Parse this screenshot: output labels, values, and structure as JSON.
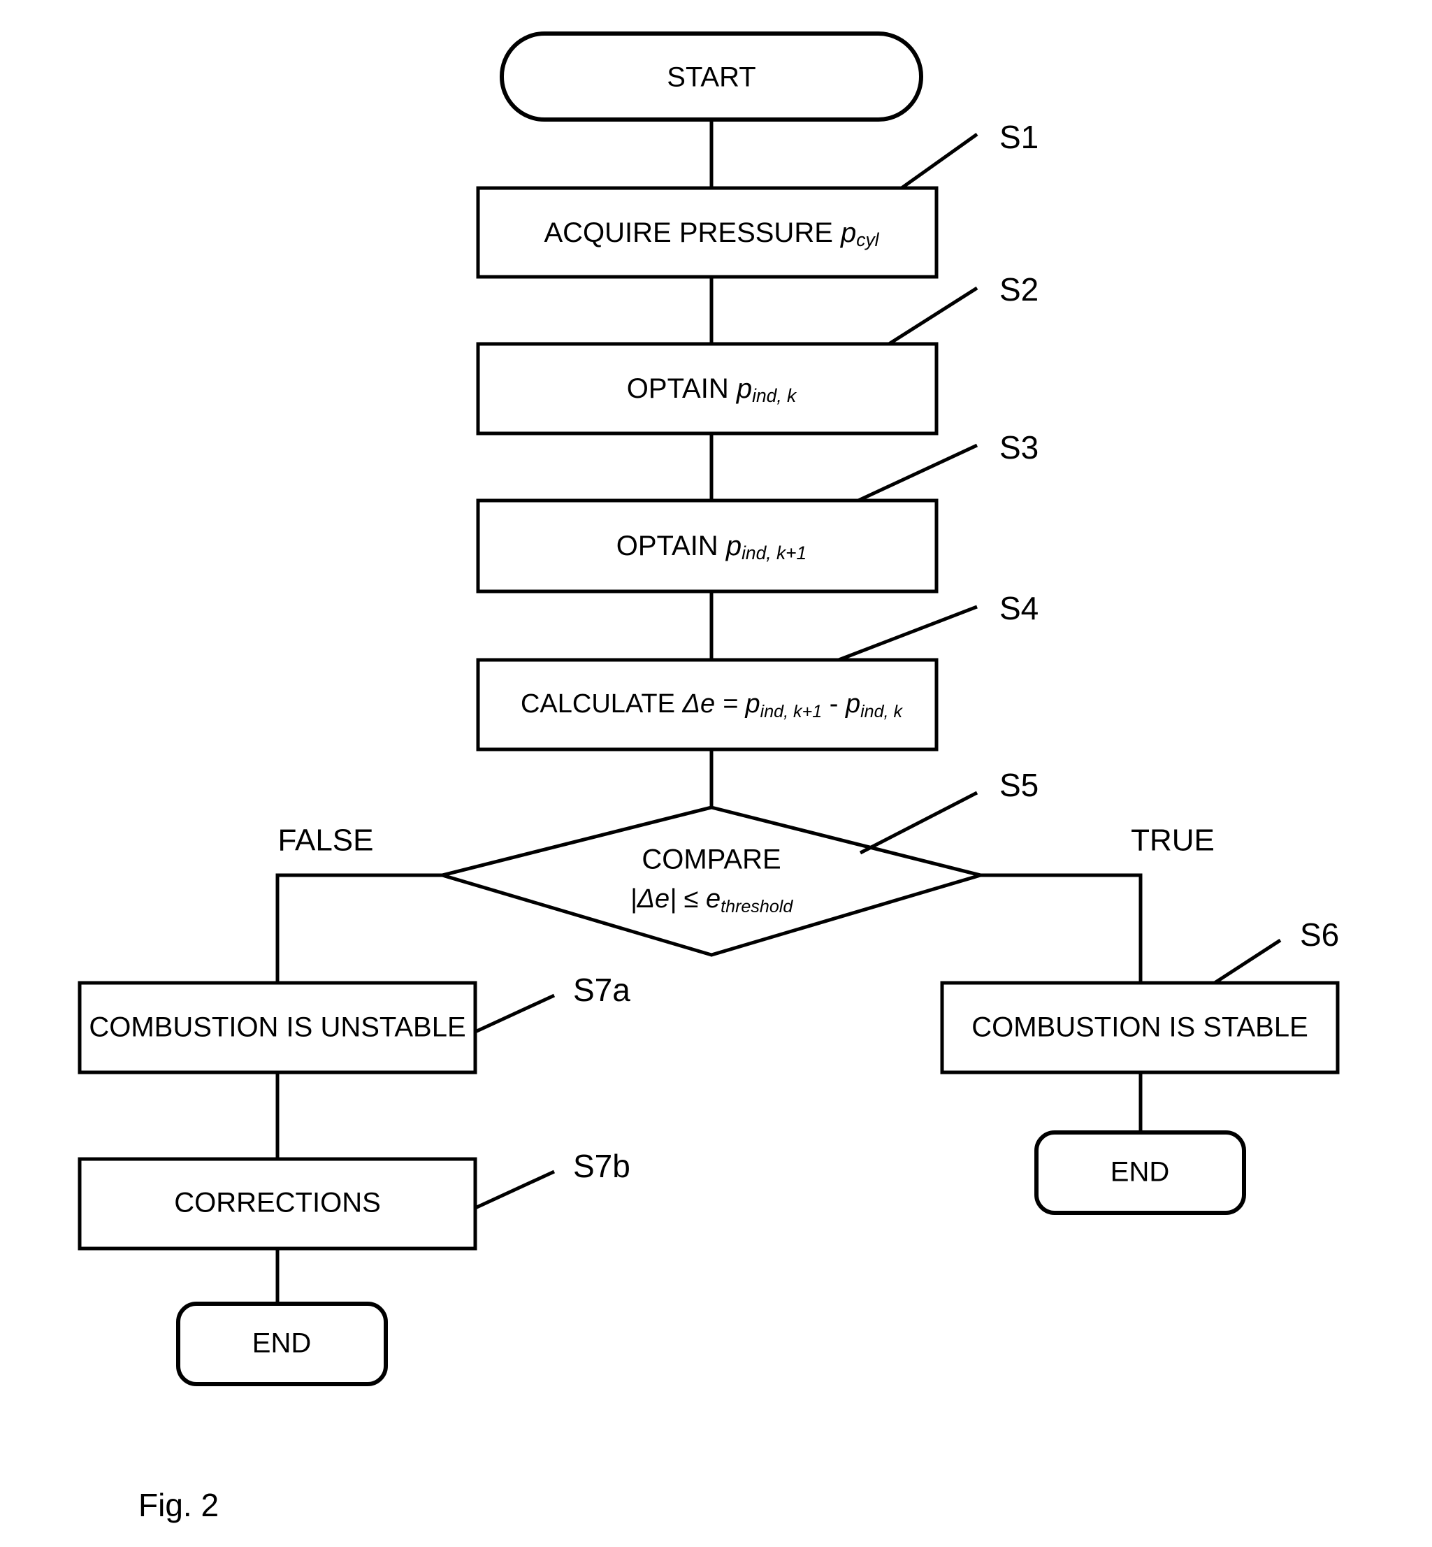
{
  "figure": {
    "caption": "Fig. 2",
    "type": "flowchart"
  },
  "nodes": {
    "start": {
      "label": "START",
      "shape": "terminator"
    },
    "s1": {
      "tag": "S1",
      "shape": "process",
      "text_main": "ACQUIRE PRESSURE ",
      "text_var": "p",
      "text_sub": "cyl"
    },
    "s2": {
      "tag": "S2",
      "shape": "process",
      "text_main": "OPTAIN ",
      "text_var": "p",
      "text_sub": "ind, k"
    },
    "s3": {
      "tag": "S3",
      "shape": "process",
      "text_main": "OPTAIN ",
      "text_var": "p",
      "text_sub": "ind, k+1"
    },
    "s4": {
      "tag": "S4",
      "shape": "process",
      "text_main": "CALCULATE ",
      "text_var": "Δe = ",
      "text_var2": "p",
      "text_sub": "ind, k+1",
      "text_op": "  -  ",
      "text_var3": "p",
      "text_sub2": "ind, k"
    },
    "s5": {
      "tag": "S5",
      "shape": "decision",
      "line1": "COMPARE",
      "line2_a": "|Δe|",
      "line2_b": " ≤  ",
      "line2_c": "e",
      "line2_sub": "threshold",
      "branch_false": "FALSE",
      "branch_true": "TRUE"
    },
    "s6": {
      "tag": "S6",
      "shape": "process",
      "label": "COMBUSTION IS STABLE"
    },
    "s7a": {
      "tag": "S7a",
      "shape": "process",
      "label": "COMBUSTION IS UNSTABLE"
    },
    "s7b": {
      "tag": "S7b",
      "shape": "process",
      "label": "CORRECTIONS"
    },
    "end_left": {
      "label": "END",
      "shape": "terminator"
    },
    "end_right": {
      "label": "END",
      "shape": "terminator"
    }
  },
  "colors": {
    "stroke": "#000000",
    "fill": "#ffffff",
    "text": "#000000"
  }
}
